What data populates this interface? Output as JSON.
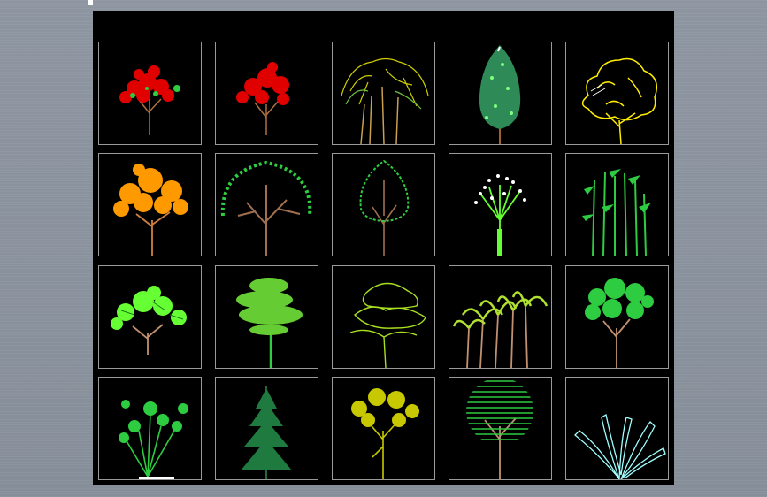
{
  "app": {
    "canvas_background": "#000000",
    "desktop_background": "#8a929d"
  },
  "palette": {
    "frame": "#9a9a9a",
    "trunk_brown": "#8b5a2b",
    "red": "#e00000",
    "green": "#2ecc40",
    "lime": "#66ff33",
    "yellow": "#ffee00",
    "orange": "#ff9900",
    "olive": "#c8c800",
    "cyan": "#9fffff",
    "white": "#ffffff"
  },
  "blocks": [
    {
      "name": "red-flowering-tree-block",
      "icon": "red-flowering-tree-icon"
    },
    {
      "name": "red-maple-tree-block",
      "icon": "red-maple-tree-icon"
    },
    {
      "name": "tree-cluster-block",
      "icon": "tree-cluster-icon"
    },
    {
      "name": "columnar-tree-block",
      "icon": "columnar-tree-icon"
    },
    {
      "name": "yellow-outline-tree-block",
      "icon": "yellow-outline-tree-icon"
    },
    {
      "name": "orange-canopy-tree-block",
      "icon": "orange-canopy-tree-icon"
    },
    {
      "name": "round-branching-tree-block",
      "icon": "round-branching-tree-icon"
    },
    {
      "name": "oval-tree-block",
      "icon": "oval-tree-icon"
    },
    {
      "name": "flowering-shrub-block",
      "icon": "flowering-shrub-icon"
    },
    {
      "name": "bamboo-block",
      "icon": "bamboo-icon"
    },
    {
      "name": "lime-spreading-tree-block",
      "icon": "lime-spreading-tree-icon"
    },
    {
      "name": "layered-pine-block",
      "icon": "layered-pine-icon"
    },
    {
      "name": "outline-layered-tree-block",
      "icon": "outline-layered-tree-icon"
    },
    {
      "name": "palm-group-block",
      "icon": "palm-group-icon"
    },
    {
      "name": "green-canopy-tree-block",
      "icon": "green-canopy-tree-icon"
    },
    {
      "name": "leafy-shrub-block",
      "icon": "leafy-shrub-icon"
    },
    {
      "name": "conifer-block",
      "icon": "conifer-icon"
    },
    {
      "name": "olive-canopy-tree-block",
      "icon": "olive-canopy-tree-icon"
    },
    {
      "name": "hatched-round-tree-block",
      "icon": "hatched-round-tree-icon"
    },
    {
      "name": "cyan-fan-plant-block",
      "icon": "cyan-fan-plant-icon"
    }
  ]
}
